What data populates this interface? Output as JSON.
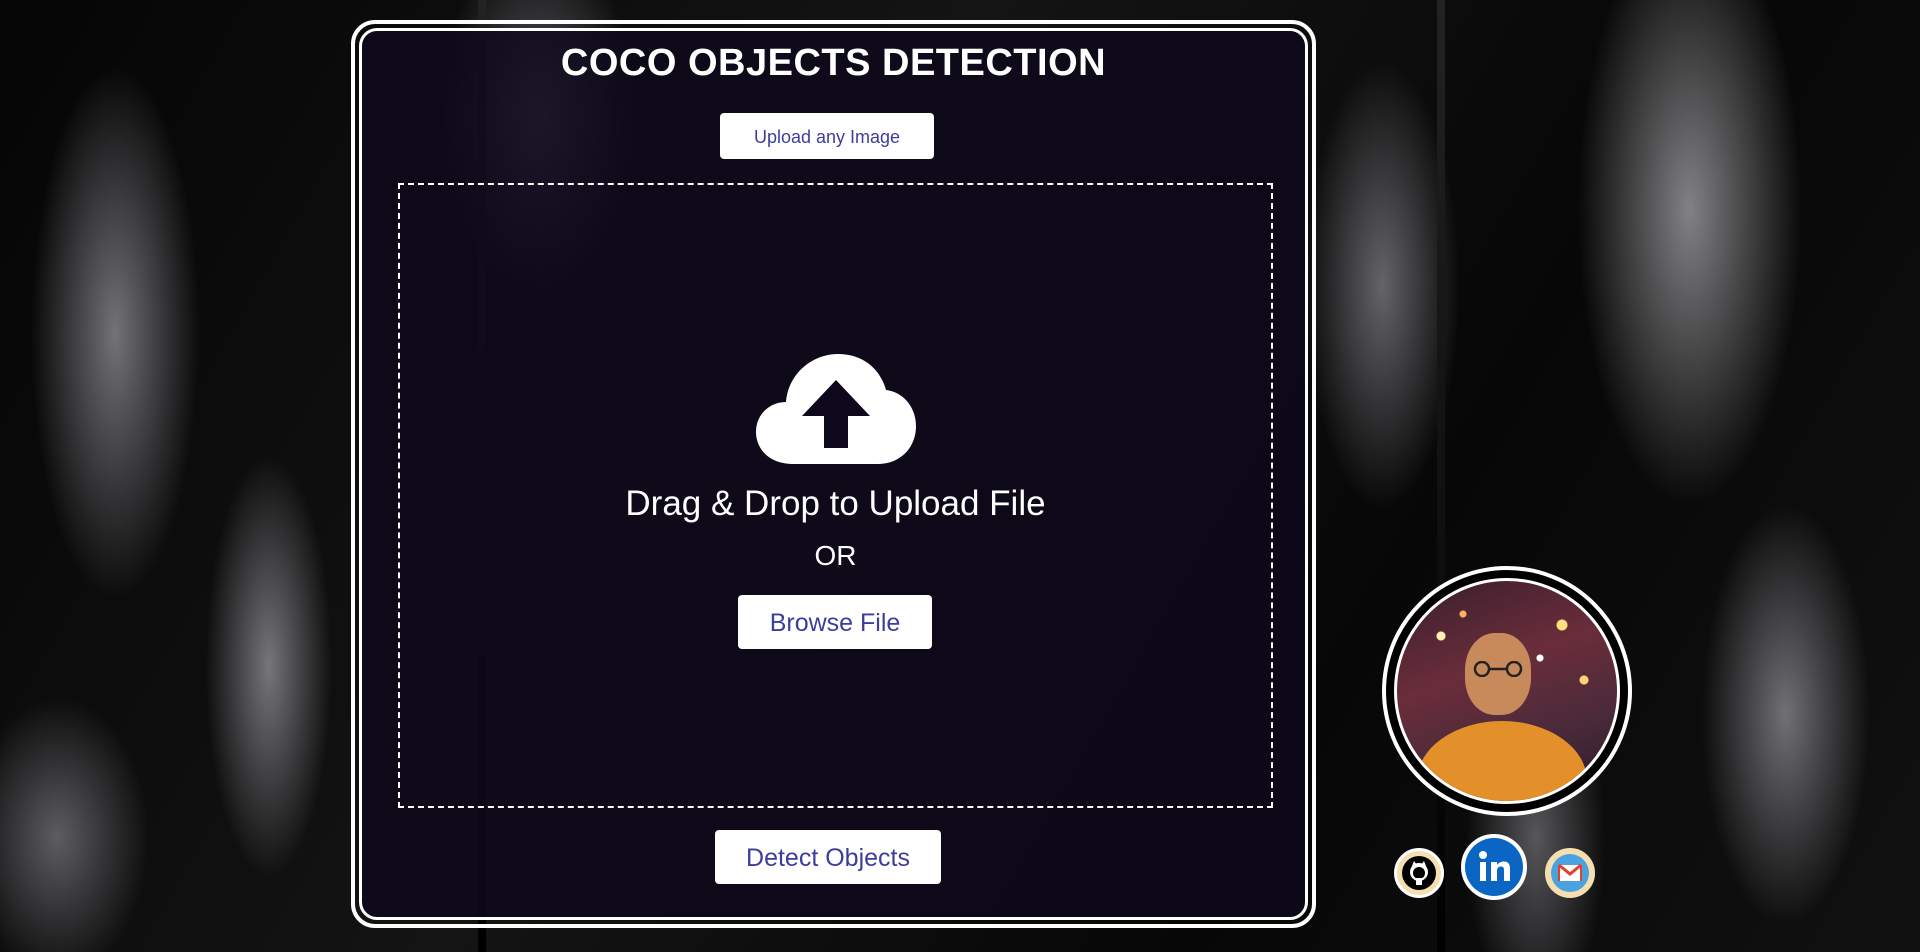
{
  "app": {
    "title": "COCO OBJECTS DETECTION"
  },
  "upload": {
    "button_label": "Upload any Image"
  },
  "dropzone": {
    "instruction": "Drag & Drop to Upload File",
    "or_text": "OR",
    "browse_label": "Browse File",
    "icon": "cloud-upload-icon"
  },
  "actions": {
    "detect_label": "Detect Objects"
  },
  "profile": {
    "avatar": "profile-photo",
    "links": [
      {
        "icon": "github-icon"
      },
      {
        "icon": "linkedin-icon"
      },
      {
        "icon": "gmail-icon"
      }
    ]
  },
  "colors": {
    "panel_bg": "#0e081c",
    "button_text": "#3d3d9e",
    "border": "#ffffff",
    "linkedin": "#0a66c2",
    "gmail": "#4aa3e0"
  }
}
